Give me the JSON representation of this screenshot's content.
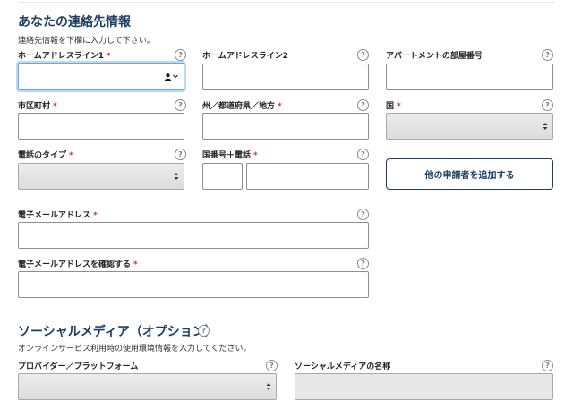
{
  "contact": {
    "title": "あなたの連絡先情報",
    "description": "連絡先情報を下欄に入力して下さい。",
    "fields": {
      "address1": {
        "label": "ホームアドレスライン1",
        "required": "*",
        "value": ""
      },
      "address2": {
        "label": "ホームアドレスライン2",
        "value": ""
      },
      "apartment": {
        "label": "アパートメントの部屋番号",
        "value": ""
      },
      "city": {
        "label": "市区町村",
        "required": "*",
        "value": ""
      },
      "state": {
        "label": "州／都道府県／地方",
        "required": "*",
        "value": ""
      },
      "country": {
        "label": "国",
        "required": "*",
        "selected": ""
      },
      "phone_type": {
        "label": "電話のタイプ",
        "required": "*",
        "selected": ""
      },
      "phone": {
        "label": "国番号＋電話",
        "required": "*",
        "country_code": "",
        "number": ""
      },
      "email": {
        "label": "電子メールアドレス",
        "required": "*",
        "value": ""
      },
      "email_confirm": {
        "label": "電子メールアドレスを確認する",
        "required": "*",
        "value": ""
      }
    },
    "add_applicant_button": "他の申請者を追加する"
  },
  "social": {
    "title": "ソーシャルメディア（オプション）",
    "description": "オンラインサービス利用時の使用環境情報を入力してください。",
    "fields": {
      "platform": {
        "label": "プロバイダー／プラットフォーム",
        "selected": ""
      },
      "name": {
        "label": "ソーシャルメディアの名称",
        "value": ""
      }
    }
  },
  "help_glyph": "?",
  "icons": {
    "autofill": "person-icon",
    "select_arrows": "updown-arrows-icon",
    "help": "question-circle-icon"
  },
  "colors": {
    "heading": "#1e3f63",
    "required": "#c0392b",
    "focus": "#6aa8df"
  }
}
